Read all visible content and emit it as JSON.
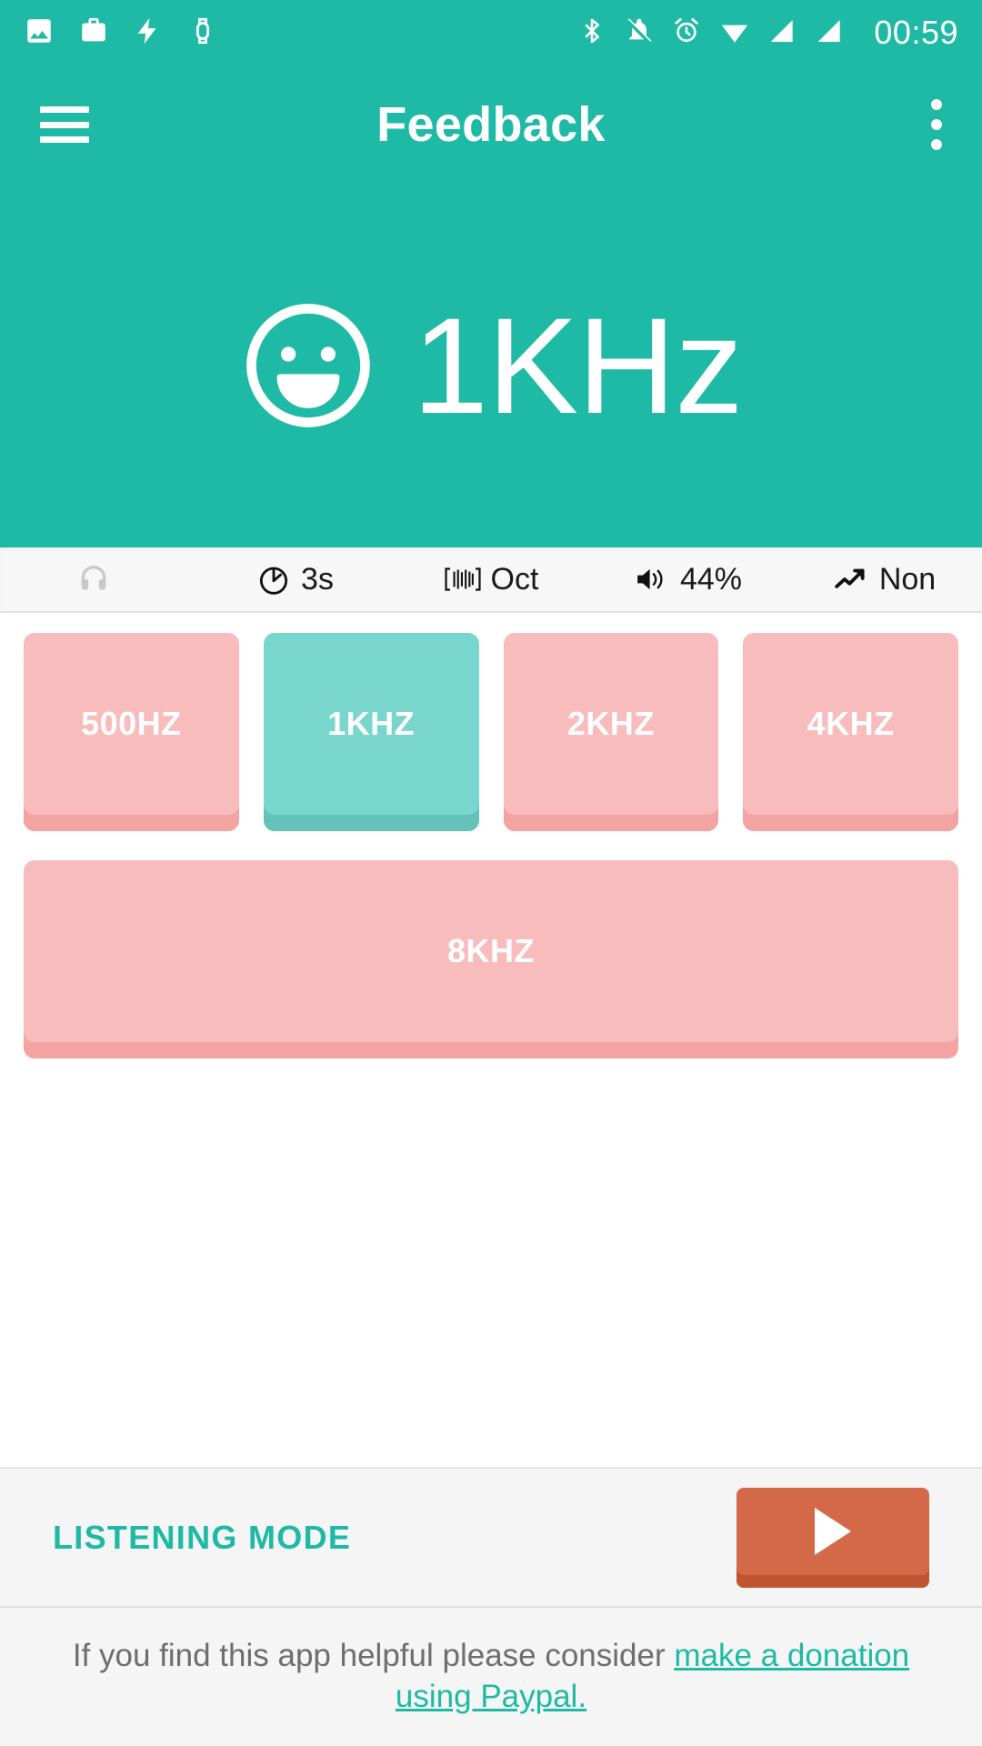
{
  "statusbar": {
    "time": "00:59",
    "left_icons": [
      "photo-icon",
      "briefcase-icon",
      "flash-icon",
      "watch-icon"
    ],
    "right_icons": [
      "bluetooth-icon",
      "notifications-off-icon",
      "alarm-icon",
      "wifi-icon",
      "signal-icon",
      "signal-icon"
    ]
  },
  "appbar": {
    "title": "Feedback",
    "menu_icon": "hamburger-icon",
    "overflow_icon": "overflow-menu-icon"
  },
  "hero": {
    "icon": "smiley-face-icon",
    "value": "1KHz"
  },
  "infostrip": {
    "items": [
      {
        "icon": "headphones-icon",
        "label": "",
        "dim": true
      },
      {
        "icon": "timer-icon",
        "label": "3s",
        "dim": false
      },
      {
        "icon": "octave-band-icon",
        "label": "Oct",
        "dim": false
      },
      {
        "icon": "volume-icon",
        "label": "44%",
        "dim": false
      },
      {
        "icon": "trending-up-icon",
        "label": "Non",
        "dim": false
      }
    ]
  },
  "frequencies": {
    "row1": [
      {
        "label": "500HZ",
        "selected": false
      },
      {
        "label": "1KHZ",
        "selected": true
      },
      {
        "label": "2KHZ",
        "selected": false
      },
      {
        "label": "4KHZ",
        "selected": false
      }
    ],
    "row2": [
      {
        "label": "8KHZ",
        "selected": false
      }
    ]
  },
  "bottombar": {
    "mode_label": "LISTENING MODE",
    "play_icon": "play-icon"
  },
  "footer": {
    "text_before": "If you find this app helpful please consider ",
    "link_text": "make a donation using Paypal."
  },
  "colors": {
    "brand_teal": "#1ebaa5",
    "button_pink": "#f9bcbc",
    "button_pink_shadow": "#f4a3a3",
    "button_teal": "#79d6cc",
    "button_teal_shadow": "#63c3b9",
    "play_orange": "#d4694a",
    "play_orange_shadow": "#bf5531",
    "strip_bg": "#f7f7f7",
    "footer_text": "#6e6e6e"
  }
}
